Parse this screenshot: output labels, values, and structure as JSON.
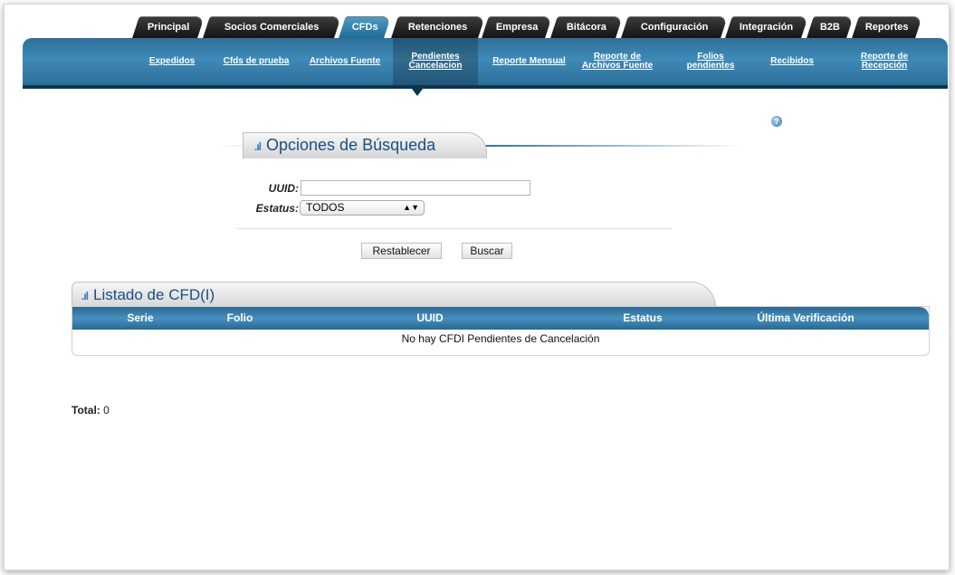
{
  "top_tabs": [
    {
      "label": "Principal"
    },
    {
      "label": "Socios Comerciales"
    },
    {
      "label": "CFDs",
      "active": true
    },
    {
      "label": "Retenciones"
    },
    {
      "label": "Empresa"
    },
    {
      "label": "Bitácora"
    },
    {
      "label": "Configuración"
    },
    {
      "label": "Integración"
    },
    {
      "label": "B2B"
    },
    {
      "label": "Reportes"
    }
  ],
  "sub_nav": [
    {
      "label": "Expedidos"
    },
    {
      "label": "Cfds de prueba"
    },
    {
      "label": "Archivos Fuente"
    },
    {
      "label": "Pendientes\nCancelacion",
      "active": true
    },
    {
      "label": "Reporte Mensual"
    },
    {
      "label": "Reporte de\nArchivos Fuente"
    },
    {
      "label": "Folios\npendientes"
    },
    {
      "label": "Recibidos"
    },
    {
      "label": "Reporte de\nRecepción"
    }
  ],
  "help_icon": {
    "glyph": "?",
    "icon": "help-icon"
  },
  "search": {
    "title": "Opciones de Búsqueda",
    "uuid_label": "UUID:",
    "uuid_value": "",
    "status_label": "Estatus:",
    "status_value": "TODOS",
    "reset_label": "Restablecer",
    "search_label": "Buscar"
  },
  "list": {
    "title": "Listado de CFD(I)",
    "columns": [
      "Serie",
      "Folio",
      "UUID",
      "Estatus",
      "Última Verificación"
    ],
    "empty_message": "No hay CFDI Pendientes de Cancelación",
    "total_label": "Total:",
    "total_value": "0"
  },
  "colors": {
    "nav_blue": "#3f8ab7",
    "dark_tab": "#1c1c1c",
    "accent": "#1a4f86"
  }
}
